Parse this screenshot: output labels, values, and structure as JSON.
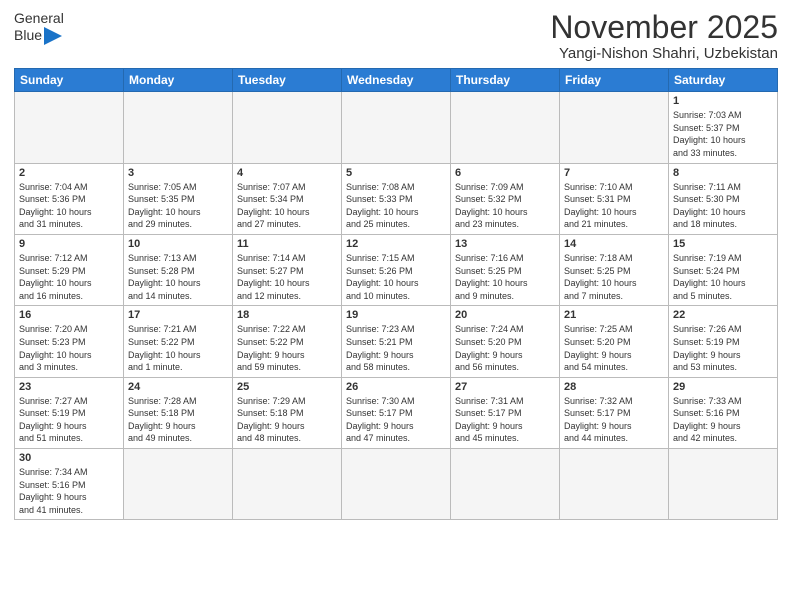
{
  "header": {
    "logo_general": "General",
    "logo_blue": "Blue",
    "title": "November 2025",
    "subtitle": "Yangi-Nishon Shahri, Uzbekistan"
  },
  "weekdays": [
    "Sunday",
    "Monday",
    "Tuesday",
    "Wednesday",
    "Thursday",
    "Friday",
    "Saturday"
  ],
  "weeks": [
    [
      {
        "day": "",
        "info": ""
      },
      {
        "day": "",
        "info": ""
      },
      {
        "day": "",
        "info": ""
      },
      {
        "day": "",
        "info": ""
      },
      {
        "day": "",
        "info": ""
      },
      {
        "day": "",
        "info": ""
      },
      {
        "day": "1",
        "info": "Sunrise: 7:03 AM\nSunset: 5:37 PM\nDaylight: 10 hours\nand 33 minutes."
      }
    ],
    [
      {
        "day": "2",
        "info": "Sunrise: 7:04 AM\nSunset: 5:36 PM\nDaylight: 10 hours\nand 31 minutes."
      },
      {
        "day": "3",
        "info": "Sunrise: 7:05 AM\nSunset: 5:35 PM\nDaylight: 10 hours\nand 29 minutes."
      },
      {
        "day": "4",
        "info": "Sunrise: 7:07 AM\nSunset: 5:34 PM\nDaylight: 10 hours\nand 27 minutes."
      },
      {
        "day": "5",
        "info": "Sunrise: 7:08 AM\nSunset: 5:33 PM\nDaylight: 10 hours\nand 25 minutes."
      },
      {
        "day": "6",
        "info": "Sunrise: 7:09 AM\nSunset: 5:32 PM\nDaylight: 10 hours\nand 23 minutes."
      },
      {
        "day": "7",
        "info": "Sunrise: 7:10 AM\nSunset: 5:31 PM\nDaylight: 10 hours\nand 21 minutes."
      },
      {
        "day": "8",
        "info": "Sunrise: 7:11 AM\nSunset: 5:30 PM\nDaylight: 10 hours\nand 18 minutes."
      }
    ],
    [
      {
        "day": "9",
        "info": "Sunrise: 7:12 AM\nSunset: 5:29 PM\nDaylight: 10 hours\nand 16 minutes."
      },
      {
        "day": "10",
        "info": "Sunrise: 7:13 AM\nSunset: 5:28 PM\nDaylight: 10 hours\nand 14 minutes."
      },
      {
        "day": "11",
        "info": "Sunrise: 7:14 AM\nSunset: 5:27 PM\nDaylight: 10 hours\nand 12 minutes."
      },
      {
        "day": "12",
        "info": "Sunrise: 7:15 AM\nSunset: 5:26 PM\nDaylight: 10 hours\nand 10 minutes."
      },
      {
        "day": "13",
        "info": "Sunrise: 7:16 AM\nSunset: 5:25 PM\nDaylight: 10 hours\nand 9 minutes."
      },
      {
        "day": "14",
        "info": "Sunrise: 7:18 AM\nSunset: 5:25 PM\nDaylight: 10 hours\nand 7 minutes."
      },
      {
        "day": "15",
        "info": "Sunrise: 7:19 AM\nSunset: 5:24 PM\nDaylight: 10 hours\nand 5 minutes."
      }
    ],
    [
      {
        "day": "16",
        "info": "Sunrise: 7:20 AM\nSunset: 5:23 PM\nDaylight: 10 hours\nand 3 minutes."
      },
      {
        "day": "17",
        "info": "Sunrise: 7:21 AM\nSunset: 5:22 PM\nDaylight: 10 hours\nand 1 minute."
      },
      {
        "day": "18",
        "info": "Sunrise: 7:22 AM\nSunset: 5:22 PM\nDaylight: 9 hours\nand 59 minutes."
      },
      {
        "day": "19",
        "info": "Sunrise: 7:23 AM\nSunset: 5:21 PM\nDaylight: 9 hours\nand 58 minutes."
      },
      {
        "day": "20",
        "info": "Sunrise: 7:24 AM\nSunset: 5:20 PM\nDaylight: 9 hours\nand 56 minutes."
      },
      {
        "day": "21",
        "info": "Sunrise: 7:25 AM\nSunset: 5:20 PM\nDaylight: 9 hours\nand 54 minutes."
      },
      {
        "day": "22",
        "info": "Sunrise: 7:26 AM\nSunset: 5:19 PM\nDaylight: 9 hours\nand 53 minutes."
      }
    ],
    [
      {
        "day": "23",
        "info": "Sunrise: 7:27 AM\nSunset: 5:19 PM\nDaylight: 9 hours\nand 51 minutes."
      },
      {
        "day": "24",
        "info": "Sunrise: 7:28 AM\nSunset: 5:18 PM\nDaylight: 9 hours\nand 49 minutes."
      },
      {
        "day": "25",
        "info": "Sunrise: 7:29 AM\nSunset: 5:18 PM\nDaylight: 9 hours\nand 48 minutes."
      },
      {
        "day": "26",
        "info": "Sunrise: 7:30 AM\nSunset: 5:17 PM\nDaylight: 9 hours\nand 47 minutes."
      },
      {
        "day": "27",
        "info": "Sunrise: 7:31 AM\nSunset: 5:17 PM\nDaylight: 9 hours\nand 45 minutes."
      },
      {
        "day": "28",
        "info": "Sunrise: 7:32 AM\nSunset: 5:17 PM\nDaylight: 9 hours\nand 44 minutes."
      },
      {
        "day": "29",
        "info": "Sunrise: 7:33 AM\nSunset: 5:16 PM\nDaylight: 9 hours\nand 42 minutes."
      }
    ],
    [
      {
        "day": "30",
        "info": "Sunrise: 7:34 AM\nSunset: 5:16 PM\nDaylight: 9 hours\nand 41 minutes."
      },
      {
        "day": "",
        "info": ""
      },
      {
        "day": "",
        "info": ""
      },
      {
        "day": "",
        "info": ""
      },
      {
        "day": "",
        "info": ""
      },
      {
        "day": "",
        "info": ""
      },
      {
        "day": "",
        "info": ""
      }
    ]
  ]
}
